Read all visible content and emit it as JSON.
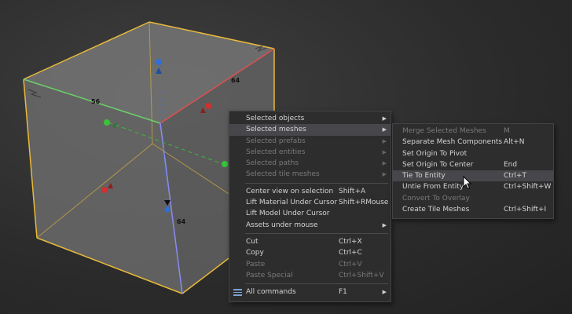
{
  "viewport": {
    "dimensions": {
      "top": "64",
      "left": "56",
      "front": "64"
    },
    "colors": {
      "edge": "#e8b93a",
      "x_axis": "#e05050",
      "y_axis": "#69d069",
      "z_axis": "#8b8bf5"
    }
  },
  "context_menu": {
    "sections": [
      [
        {
          "label": "Selected objects",
          "submenu": true,
          "disabled": false
        },
        {
          "label": "Selected meshes",
          "submenu": true,
          "disabled": false,
          "highlighted": true
        },
        {
          "label": "Selected prefabs",
          "submenu": true,
          "disabled": true
        },
        {
          "label": "Selected entities",
          "submenu": true,
          "disabled": true
        },
        {
          "label": "Selected paths",
          "submenu": true,
          "disabled": true
        },
        {
          "label": "Selected tile meshes",
          "submenu": true,
          "disabled": true
        }
      ],
      [
        {
          "label": "Center view on selection",
          "shortcut": "Shift+A"
        },
        {
          "label": "Lift Material Under Cursor",
          "shortcut": "Shift+RMouse"
        },
        {
          "label": "Lift Model Under Cursor"
        },
        {
          "label": "Assets under mouse",
          "submenu": true
        }
      ],
      [
        {
          "label": "Cut",
          "shortcut": "Ctrl+X"
        },
        {
          "label": "Copy",
          "shortcut": "Ctrl+C"
        },
        {
          "label": "Paste",
          "shortcut": "Ctrl+V",
          "disabled": true
        },
        {
          "label": "Paste Special",
          "shortcut": "Ctrl+Shift+V",
          "disabled": true
        }
      ],
      [
        {
          "label": "All commands",
          "shortcut": "F1",
          "submenu": true,
          "icon": "list-icon"
        }
      ]
    ]
  },
  "submenu": {
    "items": [
      {
        "label": "Merge Selected Meshes",
        "shortcut": "M",
        "disabled": true
      },
      {
        "label": "Separate Mesh Components",
        "shortcut": "Alt+N"
      },
      {
        "label": "Set Origin To Pivot"
      },
      {
        "label": "Set Origin To Center",
        "shortcut": "End"
      },
      {
        "label": "Tie To Entity",
        "shortcut": "Ctrl+T",
        "highlighted": true
      },
      {
        "label": "Untie From Entity",
        "shortcut": "Ctrl+Shift+W"
      },
      {
        "label": "Convert To Overlay",
        "disabled": true
      },
      {
        "label": "Create Tile Meshes",
        "shortcut": "Ctrl+Shift+I"
      }
    ]
  }
}
